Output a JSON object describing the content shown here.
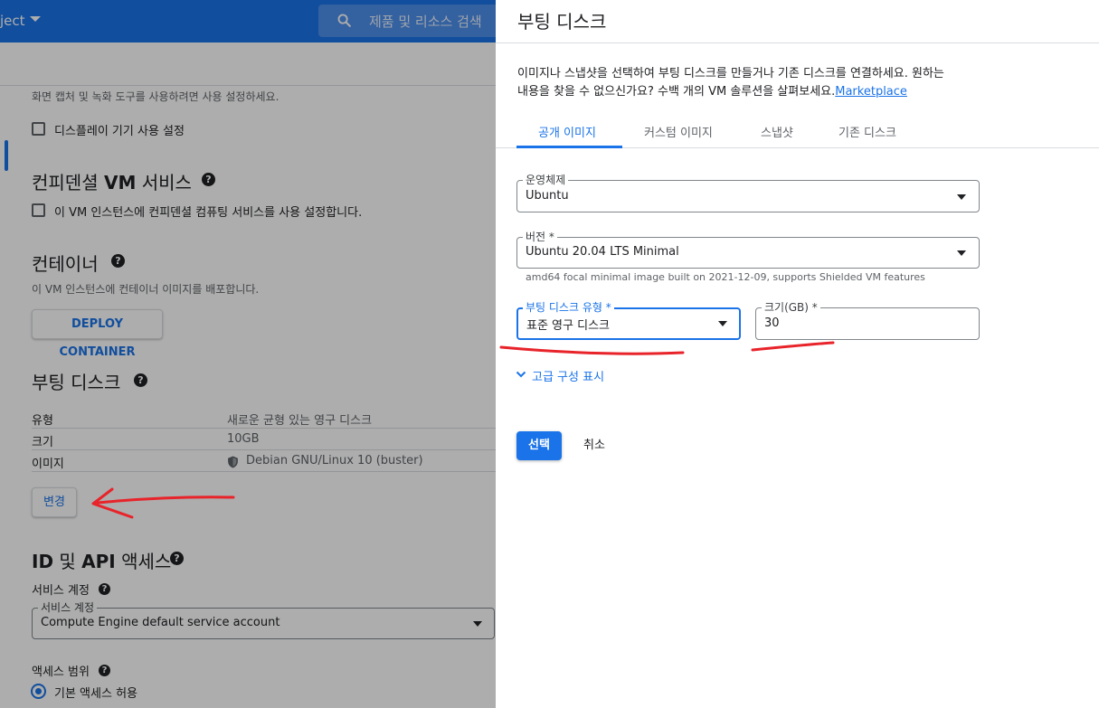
{
  "header": {
    "project_name": "ject",
    "search_placeholder": "제품 및 리소스 검색"
  },
  "main": {
    "display_hint": "화면 캡처 및 녹화 도구를 사용하려면 사용 설정하세요.",
    "display_checkbox_label": "디스플레이 기기 사용 설정",
    "confidential": {
      "title_prefix": "컨피덴셜 ",
      "title_vm": "VM",
      "title_suffix": " 서비스",
      "checkbox_label": "이 VM 인스턴스에 컨피덴셜 컴퓨팅 서비스를 사용 설정합니다."
    },
    "container": {
      "title": "컨테이너",
      "description": "이 VM 인스턴스에 컨테이너 이미지를 배포합니다.",
      "deploy_button": "DEPLOY CONTAINER"
    },
    "boot_disk": {
      "title": "부팅 디스크",
      "rows": [
        {
          "key": "유형",
          "value": "새로운 균형 있는 영구 디스크"
        },
        {
          "key": "크기",
          "value": "10GB"
        },
        {
          "key": "이미지",
          "value": "Debian GNU/Linux 10 (buster)"
        }
      ],
      "change_button": "변경"
    },
    "identity": {
      "title_prefix": "ID",
      "title_mid": " 및 ",
      "title_api": "API",
      "title_suffix": " 액세스",
      "service_account_heading": "서비스 계정",
      "service_account_field_label": "서비스 계정",
      "service_account_value": "Compute Engine default service account",
      "access_scope_heading": "액세스 범위",
      "access_scope_option": "기본 액세스 허용"
    }
  },
  "panel": {
    "title": "부팅 디스크",
    "description_line1": "이미지나 스냅샷을 선택하여 부팅 디스크를 만들거나 기존 디스크를 연결하세요. 원하는",
    "description_line2": "내용을 찾을 수 없으신가요? 수백 개의 VM 솔루션을 살펴보세요.",
    "marketplace_link": "Marketplace",
    "tabs": [
      {
        "label": "공개 이미지",
        "active": true
      },
      {
        "label": "커스텀 이미지",
        "active": false
      },
      {
        "label": "스냅샷",
        "active": false
      },
      {
        "label": "기존 디스크",
        "active": false
      }
    ],
    "os_label": "운영체제",
    "os_value": "Ubuntu",
    "version_label": "버전 *",
    "version_value": "Ubuntu 20.04 LTS Minimal",
    "version_hint": "amd64 focal minimal image built on 2021-12-09, supports Shielded VM features",
    "disk_type_label": "부팅 디스크 유형 *",
    "disk_type_value": "표준 영구 디스크",
    "size_label": "크기(GB) *",
    "size_value": "30",
    "advanced_toggle": "고급 구성 표시",
    "select_button": "선택",
    "cancel_button": "취소"
  },
  "colors": {
    "primary": "#1a73e8",
    "annotation": "#e8232a"
  }
}
